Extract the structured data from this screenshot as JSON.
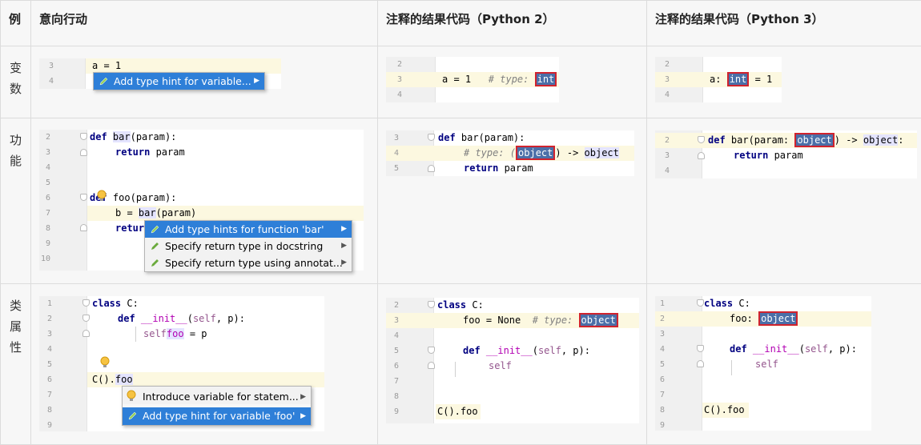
{
  "table": {
    "headers": [
      "例",
      "意向行动",
      "注释的结果代码（Python 2）",
      "注释的结果代码（Python 3）"
    ],
    "rows": [
      {
        "label_lines": [
          "变",
          "数"
        ]
      },
      {
        "label_lines": [
          "功",
          "能"
        ]
      },
      {
        "label_lines": [
          "类",
          "属",
          "性"
        ]
      }
    ]
  },
  "menus": {
    "var_action": [
      "Add type hint for variable..."
    ],
    "func_actions": [
      "Add type hints for function 'bar'",
      "Specify return type in docstring",
      "Specify return type using annotat..."
    ],
    "attr_actions": [
      "Introduce variable for statem...",
      "Add type hint for variable 'foo'"
    ]
  },
  "code": {
    "r1c1": {
      "nums": [
        "3",
        "4"
      ],
      "lines": [
        "a = 1",
        ""
      ]
    },
    "r1c2": {
      "nums": [
        "2",
        "3",
        "4"
      ],
      "lines": [
        "",
        "a = 1  ",
        " # type: ",
        "int"
      ]
    },
    "r1c3": {
      "nums": [
        "2",
        "3",
        "4"
      ],
      "lines": [
        "a: ",
        "int",
        " = 1"
      ]
    },
    "r2c1": {
      "nums": [
        "2",
        "3",
        "4",
        "5",
        "6",
        "7",
        "8",
        "9",
        "10"
      ],
      "def1": "def",
      "name1": "bar",
      "rest1": "(param):",
      "ret1": "return",
      "param1": " param",
      "def2": "def",
      "name2": " foo",
      "rest2": "(param):",
      "l7": "b = ",
      "l7b": "bar",
      "l7c": "(param)",
      "l8": "return"
    },
    "r2c2": {
      "nums": [
        "3",
        "4",
        "5"
      ],
      "def": "def",
      "sig": " bar(param):",
      "cmt": "# type: (",
      "obj": "object",
      ") ->": ") -> ",
      "obj2": "object",
      "ret": "return",
      " param": " param"
    },
    "r2c3": {
      "nums": [
        "2",
        "3",
        "4"
      ],
      "def": "def",
      "sig": " bar(param: ",
      "obj": "object",
      "arrow": ") -> ",
      "obj2": "object",
      "colon": ":",
      "ret": "return",
      "param": " param"
    },
    "r3c1": {
      "nums": [
        "1",
        "2",
        "3",
        "4",
        "5",
        "6",
        "7",
        "8",
        "9"
      ],
      "class": "class",
      "cname": " C:",
      "def": "def",
      "init": "__init__",
      "paren": "(",
      "self": "self",
      ", p):": ", p):",
      "selfb": "self",
      ".foo": ".",
      "foo": "foo",
      " = p": " = p",
      "call": "C().",
      "callfoo": "foo"
    },
    "r3c2": {
      "nums": [
        "2",
        "3",
        "4",
        "5",
        "6",
        "7",
        "8",
        "9"
      ],
      "class": "class",
      "cname": " C:",
      "foo": "foo = None  ",
      "cmt": "# type: ",
      "obj": "object",
      "def": "def",
      "init": "__init__",
      "paren": "(",
      "self": "self",
      ", p):": ", p):",
      "selfb": "self",
      ".foo = p": ".foo = p",
      "call": "C().foo"
    },
    "r3c3": {
      "nums": [
        "1",
        "2",
        "3",
        "4",
        "5",
        "6",
        "7",
        "8",
        "9"
      ],
      "class": "class",
      "cname": " C:",
      "foo": "foo: ",
      "obj": "object",
      "def": "def",
      "init": "__init__",
      "paren": "(",
      "self": "self",
      ", p):": ", p):",
      "selfb": "self",
      ".foo = p": ".foo = p",
      "call": "C().foo"
    }
  },
  "colors": {
    "selection": "#2e7fd8",
    "highlight_box": "#d0232e",
    "keyword": "#000080",
    "caret_line": "#fcf8e0"
  }
}
